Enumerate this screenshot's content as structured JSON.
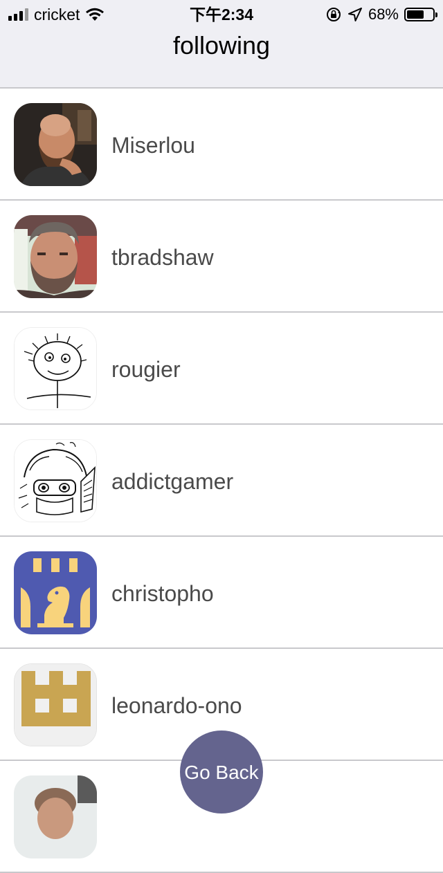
{
  "status_bar": {
    "carrier": "cricket",
    "time": "下午2:34",
    "battery_percent": "68%",
    "battery_level": 0.68,
    "icons": [
      "signal-icon",
      "wifi-icon",
      "orientation-lock-icon",
      "location-arrow-icon",
      "battery-icon"
    ]
  },
  "header": {
    "title": "following"
  },
  "following": [
    {
      "username": "Miserlou",
      "avatar": "photo-avatar"
    },
    {
      "username": "tbradshaw",
      "avatar": "photo-avatar"
    },
    {
      "username": "rougier",
      "avatar": "sketch-face-avatar"
    },
    {
      "username": "addictgamer",
      "avatar": "sketch-character-avatar"
    },
    {
      "username": "christopho",
      "avatar": "chess-rook-knight-avatar"
    },
    {
      "username": "leonardo-ono",
      "avatar": "identicon-avatar"
    },
    {
      "username": "",
      "avatar": "photo-avatar"
    }
  ],
  "go_back_button": {
    "label": "Go Back"
  },
  "colors": {
    "header_background": "#efeff4",
    "divider": "#c8c8cc",
    "username_text": "#4a4a4a",
    "go_back_background": "#64648e",
    "christopho_blue": "#4f5ab0",
    "christopho_yellow": "#f8d37c",
    "leonardo_gold": "#c9a552"
  }
}
